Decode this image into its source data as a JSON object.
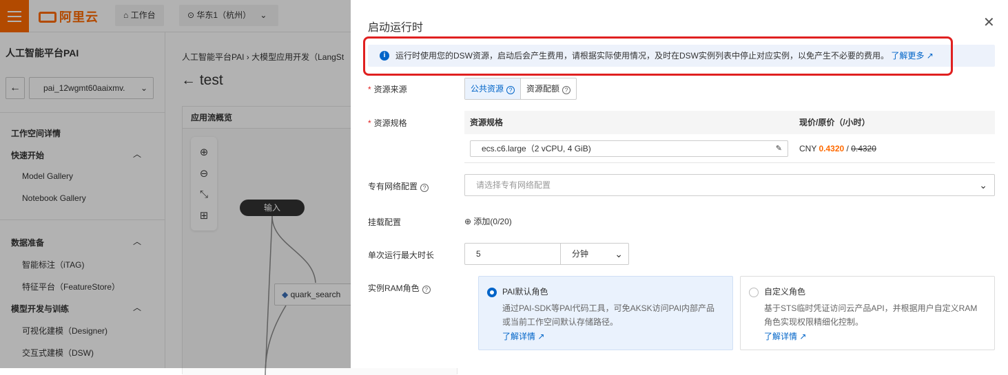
{
  "topbar": {
    "logo": "阿里云",
    "workbench_tab": "工作台",
    "region": "华东1（杭州）"
  },
  "sidebar": {
    "title": "人工智能平台PAI",
    "workspace": "pai_12wgmt60aaixmv.",
    "items": [
      {
        "label": "工作空间详情"
      },
      {
        "label": "快速开始"
      },
      {
        "label": "Model Gallery"
      },
      {
        "label": "Notebook Gallery"
      },
      {
        "label": "数据准备"
      },
      {
        "label": "智能标注（iTAG)"
      },
      {
        "label": "特征平台（FeatureStore）"
      },
      {
        "label": "模型开发与训练"
      },
      {
        "label": "可视化建模（Designer)"
      },
      {
        "label": "交互式建模（DSW)"
      }
    ]
  },
  "main": {
    "breadcrumb": "人工智能平台PAI  ›  大模型应用开发（LangSt",
    "title": "test",
    "flow_card_title": "应用流概览",
    "node_input": "输入",
    "node_tool": "quark_search"
  },
  "drawer": {
    "title": "启动运行时",
    "notice_text": "运行时使用您的DSW资源，启动后会产生费用，请根据实际使用情况，及时在DSW实例列表中停止对应实例，以免产生不必要的费用。",
    "notice_link": "了解更多",
    "resource_source_label": "资源来源",
    "resource_source_options": [
      "公共资源",
      "资源配额"
    ],
    "resource_spec_label": "资源规格",
    "spec_table": {
      "col_spec": "资源规格",
      "col_price": "现价/原价（/小时）",
      "spec_value": "ecs.c6.large（2 vCPU, 4 GiB)",
      "price_prefix": "CNY",
      "price_now": "0.4320",
      "price_sep": " / ",
      "price_orig": "0.4320"
    },
    "vpc_label": "专有网络配置",
    "vpc_placeholder": "请选择专有网络配置",
    "mount_label": "挂载配置",
    "mount_add": "添加(0/20)",
    "max_duration_label": "单次运行最大时长",
    "max_duration_value": "5",
    "max_duration_unit": "分钟",
    "ram_label": "实例RAM角色",
    "roles": [
      {
        "name": "PAI默认角色",
        "desc": "通过PAI-SDK等PAI代码工具，可免AKSK访问PAI内部产品或当前工作空间默认存储路径。",
        "link": "了解详情"
      },
      {
        "name": "自定义角色",
        "desc": "基于STS临时凭证访问云产品API，并根据用户自定义RAM角色实现权限精细化控制。",
        "link": "了解详情"
      }
    ]
  },
  "colors": {
    "brand": "#ff6a00",
    "primary": "#0064c8",
    "highlight": "#e02020"
  }
}
